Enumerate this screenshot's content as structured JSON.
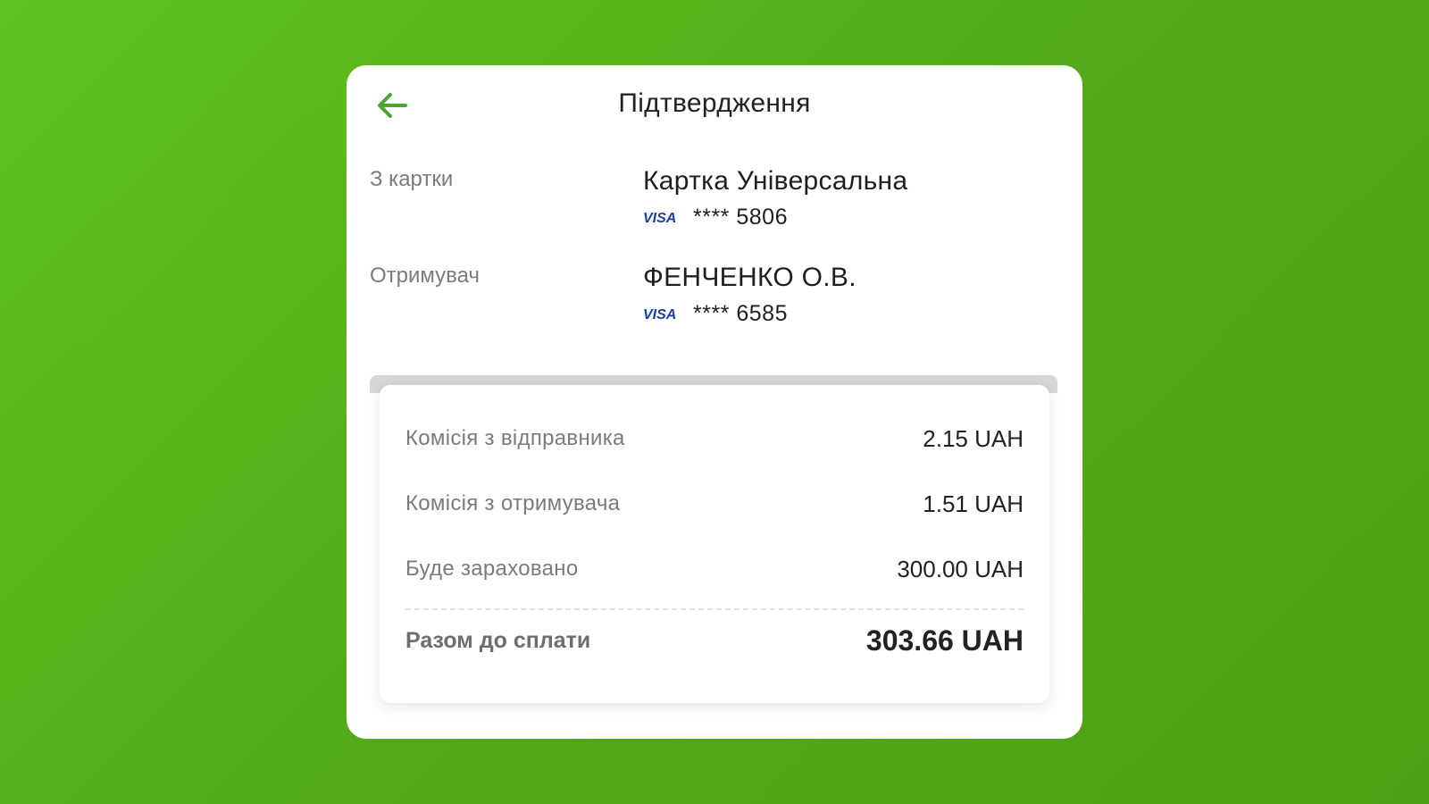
{
  "colors": {
    "background": "#56b11b",
    "accent_green": "#4aa52e",
    "visa_blue": "#1a3fa0"
  },
  "header": {
    "title": "Підтвердження",
    "back_icon": "arrow-left-icon"
  },
  "from_card": {
    "label": "З картки",
    "name": "Картка Універсальна",
    "brand": "VISA",
    "masked_number": "**** 5806"
  },
  "recipient": {
    "label": "Отримувач",
    "name": "ФЕНЧЕНКО О.В.",
    "brand": "VISA",
    "masked_number": "**** 6585"
  },
  "summary": {
    "rows": [
      {
        "label": "Комісія з відправника",
        "value": "2.15 UAH"
      },
      {
        "label": "Комісія з отримувача",
        "value": "1.51 UAH"
      },
      {
        "label": "Буде зараховано",
        "value": "300.00 UAH"
      }
    ],
    "total_label": "Разом до сплати",
    "total_value": "303.66 UAH"
  }
}
